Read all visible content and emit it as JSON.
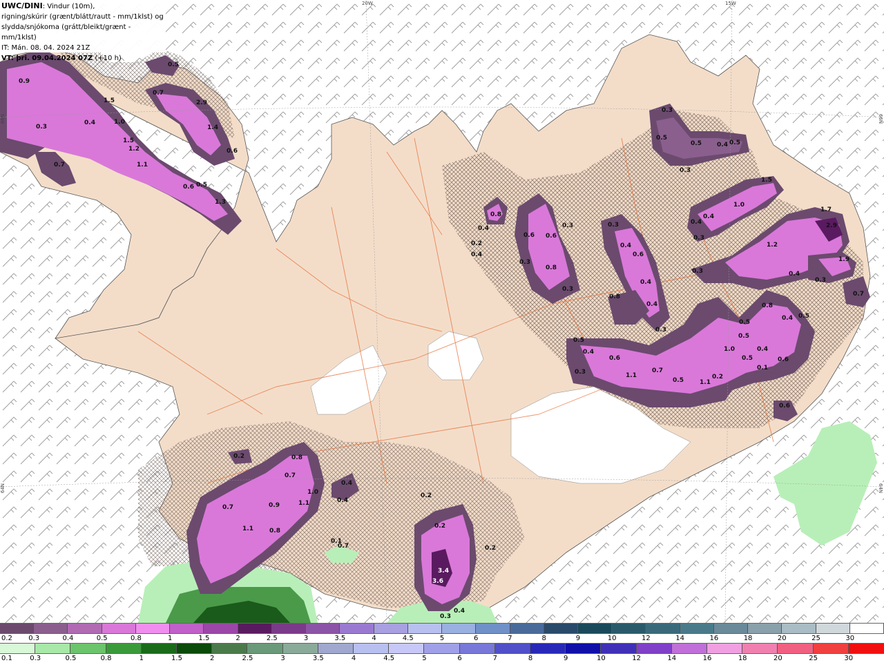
{
  "header": {
    "title_bold": "UWC/DINI",
    "title_rest": ": Vindur (10m),",
    "line2": "rigning/skúrir (grænt/blátt/rautt - mm/1klst) og",
    "line3": "slydda/snjókoma (grátt/bleikt/grænt - mm/1klst)",
    "it": "IT: Mán. 08. 04. 2024 21Z",
    "vt_bold": "VT: þri. 09.04.2024 07Z",
    "vt_rest": " (+10 h)"
  },
  "coords": {
    "top_lon_1": "20W",
    "top_lon_2": "15W",
    "left_lat_1": "66N",
    "left_lat_2": "64N",
    "right_lat_1": "66N",
    "right_lat_2": "64N"
  },
  "legend_snow": {
    "labels": [
      "0.2",
      "0.3",
      "0.4",
      "0.5",
      "0.8",
      "1",
      "1.5",
      "2",
      "2.5",
      "3",
      "3.5",
      "4",
      "4.5",
      "5",
      "6",
      "7",
      "8",
      "9",
      "10",
      "12",
      "14",
      "16",
      "18",
      "20",
      "25",
      "30"
    ],
    "colors": [
      "#6b4a6e",
      "#8a5f8e",
      "#b06bb3",
      "#d978d9",
      "#f08ef0",
      "#c060c8",
      "#9b47a8",
      "#5a1a60",
      "#7c3a8a",
      "#8c54a6",
      "#9a7ad0",
      "#a8a0e0",
      "#b8c0f0",
      "#9ab0e0",
      "#7090c8",
      "#4a6a9a",
      "#2a4a6a",
      "#1a4a5a",
      "#2a5a6a",
      "#3a6a7a",
      "#4a7a8a",
      "#6a8a9a",
      "#8aa0aa",
      "#aabcc4",
      "#d0d8dc",
      "#ffffff"
    ]
  },
  "legend_rain": {
    "labels": [
      "0.1",
      "0.3",
      "0.5",
      "0.8",
      "1",
      "1.5",
      "2",
      "2.5",
      "3",
      "3.5",
      "4",
      "4.5",
      "5",
      "6",
      "7",
      "8",
      "9",
      "10",
      "12",
      "14",
      "16",
      "18",
      "20",
      "25",
      "30"
    ],
    "colors": [
      "#d8f8d8",
      "#a8e8a8",
      "#6cc46c",
      "#3a9a3a",
      "#1a6a1a",
      "#0a4a0a",
      "#4a7a4a",
      "#6a9a7a",
      "#8aaa9a",
      "#a0a8d0",
      "#b8c0f0",
      "#c8c8f8",
      "#a0a0e8",
      "#7878d8",
      "#5050c8",
      "#2828b8",
      "#1010a8",
      "#4030b8",
      "#8040c8",
      "#c070d8",
      "#f0a0e0",
      "#f080b0",
      "#f06080",
      "#f04040",
      "#f01010"
    ]
  },
  "map_values": [
    {
      "v": "0.9"
    },
    {
      "v": "0.3"
    },
    {
      "v": "1.5"
    },
    {
      "v": "1.0"
    },
    {
      "v": "0.4"
    },
    {
      "v": "1.5"
    },
    {
      "v": "1.2"
    },
    {
      "v": "1.1"
    },
    {
      "v": "0.7"
    },
    {
      "v": "0.5"
    },
    {
      "v": "0.7"
    },
    {
      "v": "2.9"
    },
    {
      "v": "1.4"
    },
    {
      "v": "0.6"
    },
    {
      "v": "0.6"
    },
    {
      "v": "0.5"
    },
    {
      "v": "1.3"
    },
    {
      "v": "0.3"
    },
    {
      "v": "0.5"
    },
    {
      "v": "0.5"
    },
    {
      "v": "0.4"
    },
    {
      "v": "0.5"
    },
    {
      "v": "0.3"
    },
    {
      "v": "0.8"
    },
    {
      "v": "0.4"
    },
    {
      "v": "0.4"
    },
    {
      "v": "0.2"
    },
    {
      "v": "0.6"
    },
    {
      "v": "0.6"
    },
    {
      "v": "0.3"
    },
    {
      "v": "0.3"
    },
    {
      "v": "0.8"
    },
    {
      "v": "0.3"
    },
    {
      "v": "0.3"
    },
    {
      "v": "0.4"
    },
    {
      "v": "0.6"
    },
    {
      "v": "0.4"
    },
    {
      "v": "0.4"
    },
    {
      "v": "0.8"
    },
    {
      "v": "0.3"
    },
    {
      "v": "1.5"
    },
    {
      "v": "1.0"
    },
    {
      "v": "0.4"
    },
    {
      "v": "0.4"
    },
    {
      "v": "0.3"
    },
    {
      "v": "1.7"
    },
    {
      "v": "2.9"
    },
    {
      "v": "1.2"
    },
    {
      "v": "0.3"
    },
    {
      "v": "1.9"
    },
    {
      "v": "0.3"
    },
    {
      "v": "0.7"
    },
    {
      "v": "0.5"
    },
    {
      "v": "0.4"
    },
    {
      "v": "0.3"
    },
    {
      "v": "0.6"
    },
    {
      "v": "1.1"
    },
    {
      "v": "0.7"
    },
    {
      "v": "0.5"
    },
    {
      "v": "1.1"
    },
    {
      "v": "0.2"
    },
    {
      "v": "0.5"
    },
    {
      "v": "1.0"
    },
    {
      "v": "0.5"
    },
    {
      "v": "0.5"
    },
    {
      "v": "0.4"
    },
    {
      "v": "0.1"
    },
    {
      "v": "0.6"
    },
    {
      "v": "0.8"
    },
    {
      "v": "0.4"
    },
    {
      "v": "0.4"
    },
    {
      "v": "0.5"
    },
    {
      "v": "0.6"
    },
    {
      "v": "0.2"
    },
    {
      "v": "0.8"
    },
    {
      "v": "0.7"
    },
    {
      "v": "0.7"
    },
    {
      "v": "0.9"
    },
    {
      "v": "1.0"
    },
    {
      "v": "1.1"
    },
    {
      "v": "1.1"
    },
    {
      "v": "0.8"
    },
    {
      "v": "0.4"
    },
    {
      "v": "0.4"
    },
    {
      "v": "0.1"
    },
    {
      "v": "0.7"
    },
    {
      "v": "0.2"
    },
    {
      "v": "0.2"
    },
    {
      "v": "3.4"
    },
    {
      "v": "3.6"
    },
    {
      "v": "0.4"
    },
    {
      "v": "0.3"
    },
    {
      "v": "0.2"
    }
  ]
}
